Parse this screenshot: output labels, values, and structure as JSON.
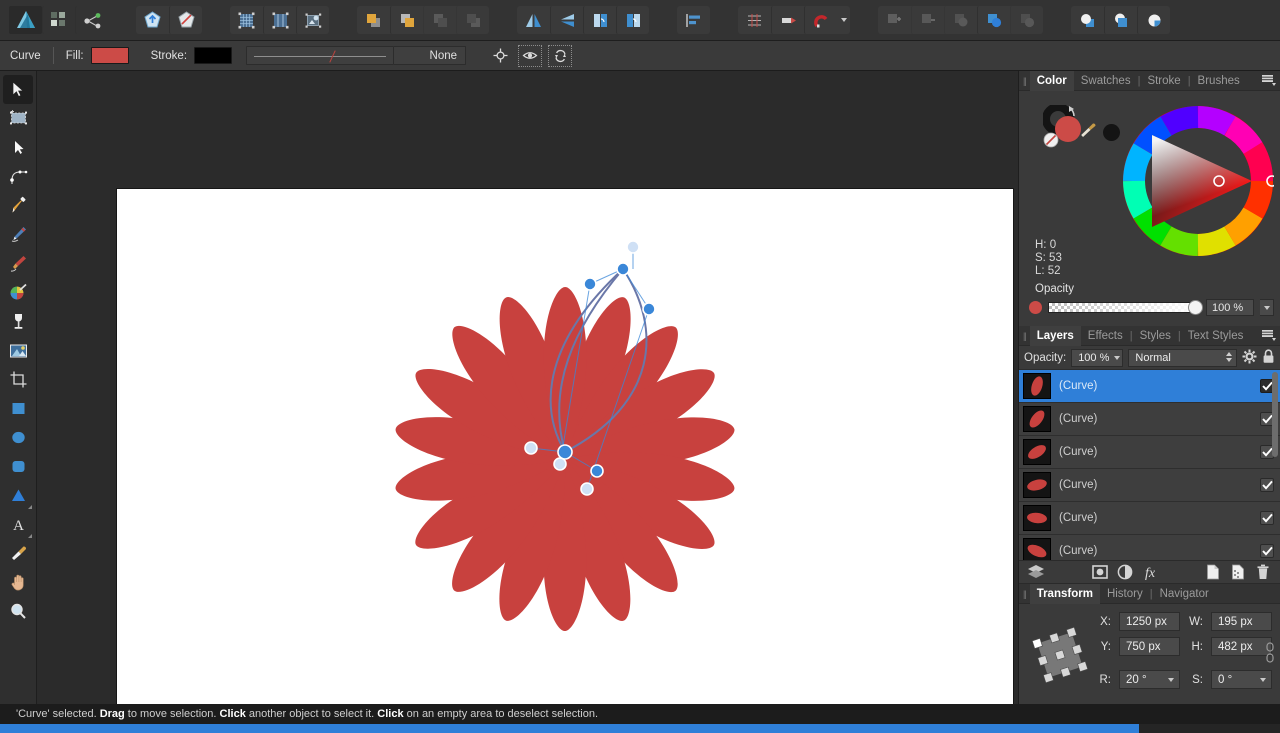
{
  "app": {
    "name": "Affinity Designer"
  },
  "toolbar": {
    "groups": [
      {
        "name": "app-logo-group",
        "buttons": [
          {
            "name": "affinity-logo-icon",
            "label": "Affinity",
            "state": "active"
          },
          {
            "name": "grid-layout-icon",
            "label": "Arrange Documents",
            "state": "normal"
          },
          {
            "name": "share-icon",
            "label": "Share",
            "state": "normal"
          }
        ]
      },
      {
        "name": "persona-group",
        "buttons": [
          {
            "name": "draw-persona-icon",
            "label": "Draw Persona",
            "state": "normal"
          },
          {
            "name": "pixel-persona-icon",
            "label": "Pixel Persona",
            "state": "normal"
          }
        ]
      },
      {
        "name": "view-group",
        "buttons": [
          {
            "name": "show-grid-icon",
            "label": "Show Grid",
            "state": "normal"
          },
          {
            "name": "show-guides-icon",
            "label": "Show Guides",
            "state": "normal"
          },
          {
            "name": "edit-in-place-icon",
            "label": "Edit In Place",
            "state": "normal"
          }
        ]
      },
      {
        "name": "arrange-group",
        "buttons": [
          {
            "name": "move-to-front-icon",
            "label": "Move To Front",
            "state": "normal"
          },
          {
            "name": "move-forward-icon",
            "label": "Move Forward",
            "state": "normal"
          },
          {
            "name": "move-backward-icon",
            "label": "Move Backward",
            "state": "disabled"
          },
          {
            "name": "move-to-back-icon",
            "label": "Move To Back",
            "state": "disabled"
          }
        ]
      },
      {
        "name": "flip-group",
        "buttons": [
          {
            "name": "flip-horizontal-icon",
            "label": "Flip Horizontal",
            "state": "normal"
          },
          {
            "name": "flip-vertical-icon",
            "label": "Flip Vertical",
            "state": "normal"
          },
          {
            "name": "rotate-left-icon",
            "label": "Rotate Left",
            "state": "normal"
          },
          {
            "name": "rotate-right-icon",
            "label": "Rotate Right",
            "state": "normal"
          }
        ]
      },
      {
        "name": "align-group",
        "buttons": [
          {
            "name": "alignment-icon",
            "label": "Alignment",
            "state": "normal"
          }
        ]
      },
      {
        "name": "snapping-group",
        "buttons": [
          {
            "name": "grid-snapping-icon",
            "label": "Grid",
            "state": "normal"
          },
          {
            "name": "snapping-candidates-icon",
            "label": "Snapping Candidates",
            "state": "normal"
          },
          {
            "name": "magnet-snapping-icon",
            "label": "Snapping",
            "state": "normal"
          }
        ]
      },
      {
        "name": "boolean-group",
        "buttons": [
          {
            "name": "boolean-add-icon",
            "label": "Add",
            "state": "disabled"
          },
          {
            "name": "boolean-subtract-icon",
            "label": "Subtract",
            "state": "disabled"
          },
          {
            "name": "boolean-intersect-icon",
            "label": "Intersect",
            "state": "disabled"
          },
          {
            "name": "boolean-divide-icon",
            "label": "Divide",
            "state": "normal"
          },
          {
            "name": "boolean-combine-icon",
            "label": "Combine",
            "state": "disabled"
          }
        ]
      },
      {
        "name": "geometry-group",
        "buttons": [
          {
            "name": "expand-stroke-icon",
            "label": "Expand Stroke",
            "state": "normal"
          },
          {
            "name": "merge-curves-icon",
            "label": "Merge Curves",
            "state": "normal"
          },
          {
            "name": "separate-curves-icon",
            "label": "Separate Curves",
            "state": "normal"
          }
        ]
      }
    ]
  },
  "context_bar": {
    "object_type": "Curve",
    "fill_label": "Fill:",
    "fill_color": "#cc4b47",
    "stroke_label": "Stroke:",
    "stroke_color": "#000000",
    "stroke_width": "None",
    "icons": [
      {
        "name": "transform-origin-icon",
        "label": "Transform Origin"
      },
      {
        "name": "preview-mode-icon",
        "label": "Preview Mode"
      },
      {
        "name": "cycle-selection-icon",
        "label": "Cycle Selection"
      }
    ]
  },
  "tools": [
    {
      "name": "move-tool",
      "label": "Move Tool",
      "icon": "cursor-arrow-icon",
      "active": true,
      "flyout": false
    },
    {
      "name": "artboard-tool",
      "label": "Artboard Tool",
      "icon": "artboard-icon",
      "active": false,
      "flyout": false
    },
    {
      "name": "node-tool",
      "label": "Node Tool",
      "icon": "node-arrow-icon",
      "active": false,
      "flyout": false
    },
    {
      "name": "corner-tool",
      "label": "Corner Tool",
      "icon": "corner-icon",
      "active": false,
      "flyout": false
    },
    {
      "name": "pen-tool",
      "label": "Pen Tool",
      "icon": "pen-nib-icon",
      "active": false,
      "flyout": false
    },
    {
      "name": "pencil-tool",
      "label": "Pencil Tool",
      "icon": "pencil-icon",
      "active": false,
      "flyout": false
    },
    {
      "name": "vector-brush-tool",
      "label": "Vector Brush Tool",
      "icon": "brush-icon",
      "active": false,
      "flyout": false
    },
    {
      "name": "fill-tool",
      "label": "Fill Tool",
      "icon": "color-wheel-brush-icon",
      "active": false,
      "flyout": false
    },
    {
      "name": "transparency-tool",
      "label": "Transparency Tool",
      "icon": "goblet-icon",
      "active": false,
      "flyout": false
    },
    {
      "name": "place-image-tool",
      "label": "Place Image Tool",
      "icon": "image-icon",
      "active": false,
      "flyout": false
    },
    {
      "name": "crop-tool",
      "label": "Crop Tool",
      "icon": "crop-icon",
      "active": false,
      "flyout": false
    },
    {
      "name": "rectangle-tool",
      "label": "Rectangle Tool",
      "icon": "rectangle-icon",
      "active": false,
      "flyout": false
    },
    {
      "name": "ellipse-tool",
      "label": "Ellipse Tool",
      "icon": "ellipse-icon",
      "active": false,
      "flyout": false
    },
    {
      "name": "rounded-rectangle-tool",
      "label": "Rounded Rectangle Tool",
      "icon": "rounded-rect-icon",
      "active": false,
      "flyout": false
    },
    {
      "name": "triangle-tool",
      "label": "Triangle Tool",
      "icon": "triangle-icon",
      "active": false,
      "flyout": true
    },
    {
      "name": "artistic-text-tool",
      "label": "Artistic Text Tool",
      "icon": "text-a-icon",
      "active": false,
      "flyout": true
    },
    {
      "name": "colour-picker-tool",
      "label": "Colour Picker Tool",
      "icon": "eyedropper-icon",
      "active": false,
      "flyout": false
    },
    {
      "name": "view-tool",
      "label": "View Tool",
      "icon": "hand-icon",
      "active": false,
      "flyout": false
    },
    {
      "name": "zoom-tool",
      "label": "Zoom Tool",
      "icon": "magnifier-icon",
      "active": false,
      "flyout": false
    }
  ],
  "canvas": {
    "artwork_name": "flower",
    "petal_count": 18,
    "petal_color": "#c8413e",
    "page_background": "#ffffff",
    "selection_color": "#3a87d8",
    "selected_object": "Curve"
  },
  "color_panel": {
    "tabs": [
      {
        "label": "Color",
        "active": true
      },
      {
        "label": "Swatches",
        "active": false
      },
      {
        "label": "Stroke",
        "active": false
      },
      {
        "label": "Brushes",
        "active": false
      }
    ],
    "fill_color": "#cc4b47",
    "stroke_color": "#111111",
    "hsl": {
      "h_label": "H: 0",
      "s_label": "S: 53",
      "l_label": "L: 52"
    },
    "opacity_label": "Opacity",
    "opacity_value": "100 %"
  },
  "layers_panel": {
    "tabs": [
      {
        "label": "Layers",
        "active": true
      },
      {
        "label": "Effects",
        "active": false
      },
      {
        "label": "Styles",
        "active": false
      },
      {
        "label": "Text Styles",
        "active": false
      }
    ],
    "opacity_label": "Opacity:",
    "opacity_value": "100 %",
    "blend_mode": "Normal",
    "settings_icon": "gear-icon",
    "lock_icon": "lock-icon",
    "rows": [
      {
        "label": "(Curve)",
        "selected": true,
        "checked": true,
        "rotation": 18
      },
      {
        "label": "(Curve)",
        "selected": false,
        "checked": true,
        "rotation": 38
      },
      {
        "label": "(Curve)",
        "selected": false,
        "checked": true,
        "rotation": 58
      },
      {
        "label": "(Curve)",
        "selected": false,
        "checked": true,
        "rotation": 76
      },
      {
        "label": "(Curve)",
        "selected": false,
        "checked": true,
        "rotation": 96
      },
      {
        "label": "(Curve)",
        "selected": false,
        "checked": true,
        "rotation": 114
      }
    ],
    "footer_icons": [
      {
        "name": "layers-stack-icon",
        "label": "Layers"
      },
      {
        "name": "mask-layer-icon",
        "label": "Add Mask Layer"
      },
      {
        "name": "adjustment-layer-icon",
        "label": "Add Adjustment Layer"
      },
      {
        "name": "fx-icon",
        "label": "Layer Effects"
      },
      {
        "name": "new-layer-icon",
        "label": "Add Layer"
      },
      {
        "name": "duplicate-layer-icon",
        "label": "Duplicate"
      },
      {
        "name": "delete-layer-icon",
        "label": "Delete"
      }
    ]
  },
  "transform_panel": {
    "tabs": [
      {
        "label": "Transform",
        "active": true
      },
      {
        "label": "History",
        "active": false
      },
      {
        "label": "Navigator",
        "active": false
      }
    ],
    "fields": {
      "x_label": "X:",
      "x_value": "1250 px",
      "y_label": "Y:",
      "y_value": "750 px",
      "w_label": "W:",
      "w_value": "195 px",
      "h_label": "H:",
      "h_value": "482 px",
      "r_label": "R:",
      "r_value": "20 °",
      "s_label": "S:",
      "s_value": "0 °"
    }
  },
  "status_bar": {
    "prefix": "'Curve' selected. ",
    "b1": "Drag",
    "t1": " to move selection. ",
    "b2": "Click",
    "t2": " another object to select it. ",
    "b3": "Click",
    "t3": " on an empty area to deselect selection."
  }
}
